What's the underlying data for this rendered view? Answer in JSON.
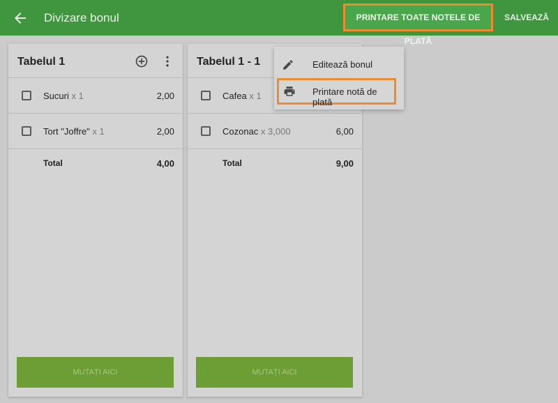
{
  "appbar": {
    "title": "Divizare bonul",
    "print_all_label": "PRINTARE TOATE NOTELE DE PLATĂ",
    "save_label": "SALVEAZĂ"
  },
  "tables": [
    {
      "title": "Tabelul 1",
      "items": [
        {
          "name": "Sucuri",
          "qty": "x 1",
          "price": "2,00"
        },
        {
          "name": "Tort \"Joffre\"",
          "qty": "x 1",
          "price": "2,00"
        }
      ],
      "total_label": "Total",
      "total_value": "4,00",
      "move_label": "MUTAȚI AICI"
    },
    {
      "title": "Tabelul 1 - 1",
      "items": [
        {
          "name": "Cafea",
          "qty": "x 1",
          "price": ""
        },
        {
          "name": "Cozonac",
          "qty": "x 3,000",
          "price": "6,00"
        }
      ],
      "total_label": "Total",
      "total_value": "9,00",
      "move_label": "MUTAȚI AICI"
    }
  ],
  "menu": {
    "edit_label": "Editează bonul",
    "print_label": "Printare notă de plată"
  },
  "colors": {
    "appbar": "#3f963f",
    "highlight": "#ee8a2f",
    "move_button": "#6d9e35"
  }
}
